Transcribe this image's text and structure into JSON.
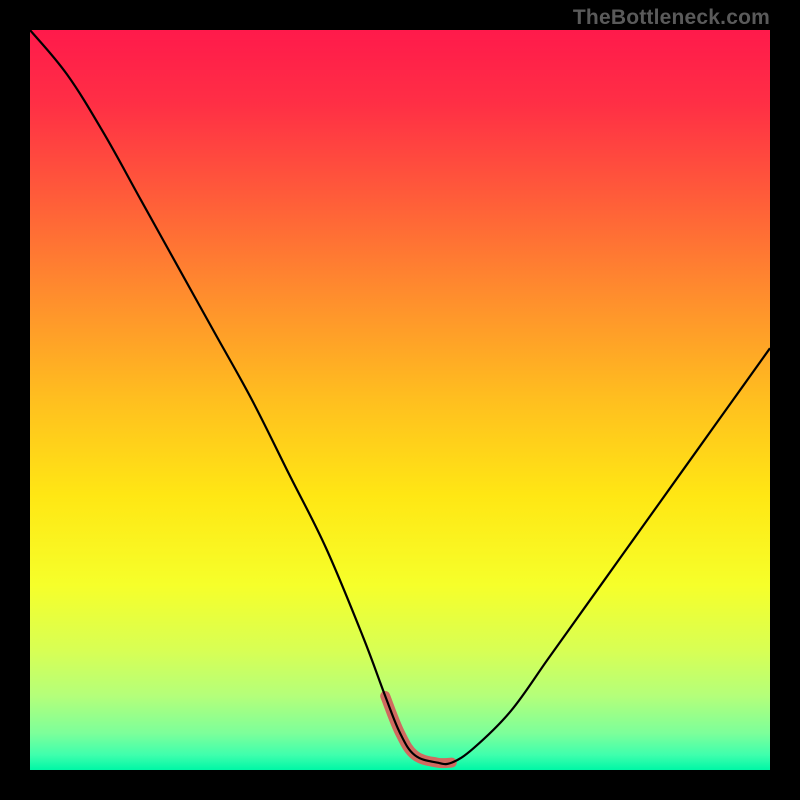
{
  "watermark": "TheBottleneck.com",
  "chart_data": {
    "type": "line",
    "title": "",
    "xlabel": "",
    "ylabel": "",
    "xlim": [
      0,
      100
    ],
    "ylim": [
      0,
      100
    ],
    "x": [
      0,
      5,
      10,
      15,
      20,
      25,
      30,
      35,
      40,
      45,
      48,
      50,
      52,
      55,
      57,
      60,
      65,
      70,
      75,
      80,
      85,
      90,
      95,
      100
    ],
    "values": [
      100,
      94,
      86,
      77,
      68,
      59,
      50,
      40,
      30,
      18,
      10,
      5,
      2,
      1,
      1,
      3,
      8,
      15,
      22,
      29,
      36,
      43,
      50,
      57
    ],
    "highlight_region": {
      "x_start": 48,
      "x_end": 58
    },
    "gradient_stops": [
      {
        "offset": 0.0,
        "color": "#ff1a4b"
      },
      {
        "offset": 0.1,
        "color": "#ff2f45"
      },
      {
        "offset": 0.22,
        "color": "#ff5a3a"
      },
      {
        "offset": 0.35,
        "color": "#ff8a2e"
      },
      {
        "offset": 0.5,
        "color": "#ffbf1f"
      },
      {
        "offset": 0.63,
        "color": "#ffe714"
      },
      {
        "offset": 0.75,
        "color": "#f6ff2a"
      },
      {
        "offset": 0.84,
        "color": "#d7ff55"
      },
      {
        "offset": 0.9,
        "color": "#b4ff7a"
      },
      {
        "offset": 0.95,
        "color": "#7dff9a"
      },
      {
        "offset": 0.98,
        "color": "#3effad"
      },
      {
        "offset": 1.0,
        "color": "#00f7a6"
      }
    ],
    "curve_color": "#000000",
    "highlight_color": "#d06a60",
    "highlight_stroke_width": 10,
    "curve_stroke_width": 2.2
  }
}
